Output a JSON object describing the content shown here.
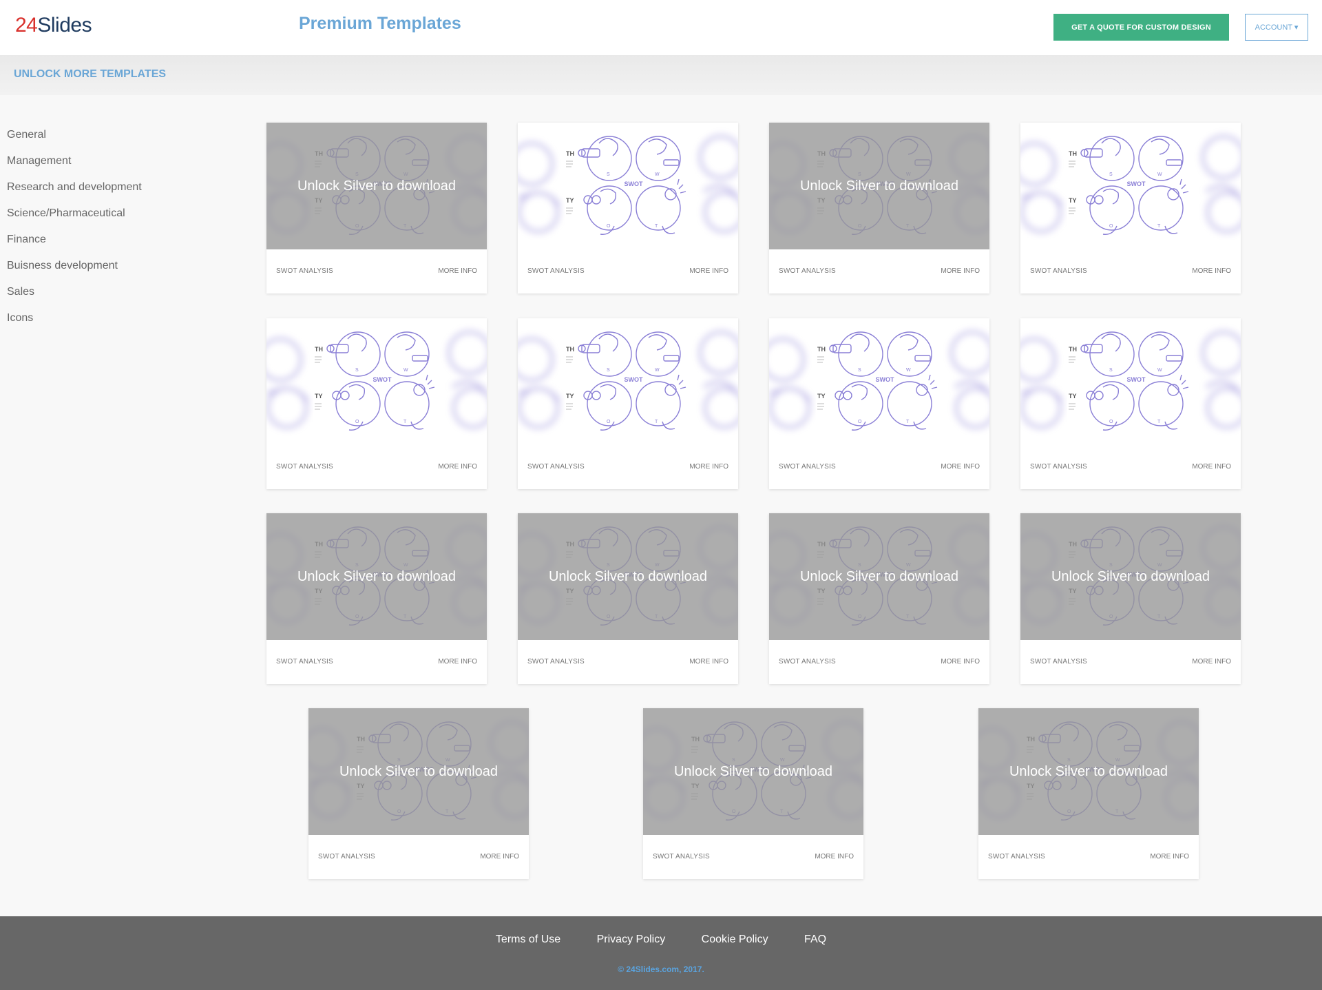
{
  "header": {
    "logo_num": "24",
    "logo_text": "Slides",
    "title": "Premium Templates",
    "quote_button": "GET A QUOTE FOR CUSTOM DESIGN",
    "account_button": "ACCOUNT ▾"
  },
  "unlock_bar": {
    "label": "UNLOCK MORE TEMPLATES"
  },
  "sidebar": {
    "items": [
      {
        "label": "General"
      },
      {
        "label": "Management"
      },
      {
        "label": "Research and development"
      },
      {
        "label": "Science/Pharmaceutical"
      },
      {
        "label": "Finance"
      },
      {
        "label": "Buisness development"
      },
      {
        "label": "Sales"
      },
      {
        "label": "Icons"
      }
    ]
  },
  "cards": [
    {
      "title": "SWOT ANALYSIS",
      "more": "MORE INFO",
      "locked": true,
      "lock_text": "Unlock Silver to download"
    },
    {
      "title": "SWOT ANALYSIS",
      "more": "MORE INFO",
      "locked": false
    },
    {
      "title": "SWOT ANALYSIS",
      "more": "MORE INFO",
      "locked": true,
      "lock_text": "Unlock Silver to download"
    },
    {
      "title": "SWOT ANALYSIS",
      "more": "MORE INFO",
      "locked": false
    },
    {
      "title": "SWOT ANALYSIS",
      "more": "MORE INFO",
      "locked": false
    },
    {
      "title": "SWOT ANALYSIS",
      "more": "MORE INFO",
      "locked": false
    },
    {
      "title": "SWOT ANALYSIS",
      "more": "MORE INFO",
      "locked": false
    },
    {
      "title": "SWOT ANALYSIS",
      "more": "MORE INFO",
      "locked": false
    },
    {
      "title": "SWOT ANALYSIS",
      "more": "MORE INFO",
      "locked": true,
      "lock_text": "Unlock Silver to download"
    },
    {
      "title": "SWOT ANALYSIS",
      "more": "MORE INFO",
      "locked": true,
      "lock_text": "Unlock Silver to download"
    },
    {
      "title": "SWOT ANALYSIS",
      "more": "MORE INFO",
      "locked": true,
      "lock_text": "Unlock Silver to download"
    },
    {
      "title": "SWOT ANALYSIS",
      "more": "MORE INFO",
      "locked": true,
      "lock_text": "Unlock Silver to download"
    },
    {
      "title": "SWOT ANALYSIS",
      "more": "MORE INFO",
      "locked": true,
      "lock_text": "Unlock Silver to download"
    },
    {
      "title": "SWOT ANALYSIS",
      "more": "MORE INFO",
      "locked": true,
      "lock_text": "Unlock Silver to download"
    },
    {
      "title": "SWOT ANALYSIS",
      "more": "MORE INFO",
      "locked": true,
      "lock_text": "Unlock Silver to download"
    }
  ],
  "thumbnail": {
    "heading_1": "TH",
    "heading_2": "TY",
    "center_label": "SWOT",
    "letters": [
      "S",
      "W",
      "O",
      "T"
    ]
  },
  "footer": {
    "links": [
      {
        "label": "Terms of Use"
      },
      {
        "label": "Privacy Policy"
      },
      {
        "label": "Cookie Policy"
      },
      {
        "label": "FAQ"
      }
    ],
    "copyright": "© 24Slides.com, 2017."
  },
  "colors": {
    "accent_blue": "#6aa6d6",
    "quote_green": "#3fb083",
    "illustration_purple": "#8a7fd6",
    "footer_gray": "#676767",
    "lock_overlay": "#969696"
  }
}
